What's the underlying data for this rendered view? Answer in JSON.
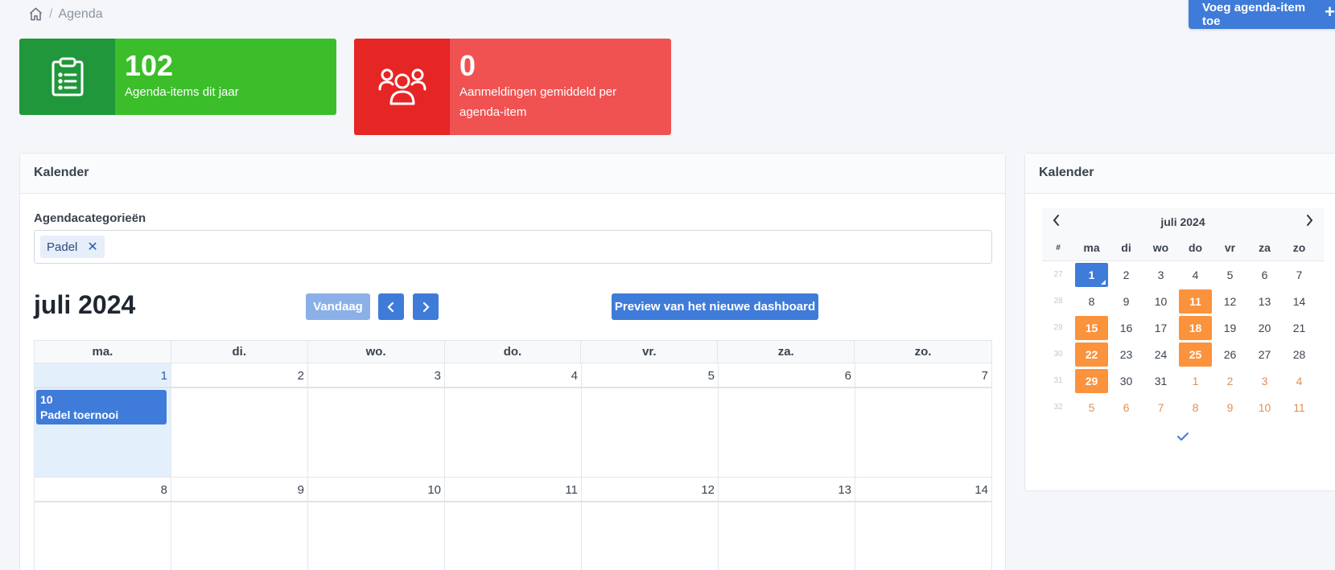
{
  "breadcrumb": {
    "current": "Agenda",
    "separator": "/"
  },
  "header": {
    "add_button": "Voeg agenda-item toe"
  },
  "stats": [
    {
      "value": "102",
      "label": "Agenda-items dit jaar",
      "color": "#3cbe2a",
      "icon": "clipboard-list-icon"
    },
    {
      "value": "0",
      "label": "Aanmeldingen gemiddeld per agenda-item",
      "color": "#f05252",
      "icon": "users-group-icon"
    }
  ],
  "main": {
    "title": "Kalender",
    "categories_label": "Agendacategorieën",
    "selected_tags": [
      "Padel"
    ],
    "month_title": "juli 2024",
    "today_button": "Vandaag",
    "preview_button": "Preview van het nieuwe dashboard",
    "weekday_headers": [
      "ma.",
      "di.",
      "wo.",
      "do.",
      "vr.",
      "za.",
      "zo."
    ],
    "weeks": [
      {
        "days": [
          "1",
          "2",
          "3",
          "4",
          "5",
          "6",
          "7"
        ]
      },
      {
        "days": [
          "8",
          "9",
          "10",
          "11",
          "12",
          "13",
          "14"
        ]
      }
    ],
    "events": [
      {
        "time": "10",
        "title": "Padel toernooi"
      }
    ]
  },
  "side": {
    "title": "Kalender",
    "month_title": "juli 2024",
    "week_header": "#",
    "weekday_headers": [
      "ma",
      "di",
      "wo",
      "do",
      "vr",
      "za",
      "zo"
    ],
    "rows": [
      {
        "week": "27",
        "days": [
          "1",
          "2",
          "3",
          "4",
          "5",
          "6",
          "7"
        ]
      },
      {
        "week": "28",
        "days": [
          "8",
          "9",
          "10",
          "11",
          "12",
          "13",
          "14"
        ]
      },
      {
        "week": "29",
        "days": [
          "15",
          "16",
          "17",
          "18",
          "19",
          "20",
          "21"
        ]
      },
      {
        "week": "30",
        "days": [
          "22",
          "23",
          "24",
          "25",
          "26",
          "27",
          "28"
        ]
      },
      {
        "week": "31",
        "days": [
          "29",
          "30",
          "31",
          "1",
          "2",
          "3",
          "4"
        ]
      },
      {
        "week": "32",
        "days": [
          "5",
          "6",
          "7",
          "8",
          "9",
          "10",
          "11"
        ]
      }
    ],
    "selected_color": "#3f7bd8",
    "highlight_color": "#fb923c"
  }
}
